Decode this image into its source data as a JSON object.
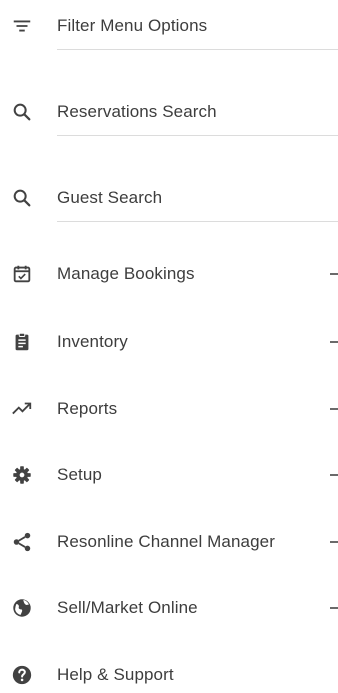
{
  "menu": {
    "filter": {
      "label": "Filter Menu Options",
      "icon": "filter-icon"
    },
    "search_items": [
      {
        "label": "Reservations Search",
        "icon": "search-icon"
      },
      {
        "label": "Guest Search",
        "icon": "search-icon"
      }
    ],
    "items": [
      {
        "label": "Manage Bookings",
        "icon": "calendar-check-icon",
        "expandable": true
      },
      {
        "label": "Inventory",
        "icon": "clipboard-icon",
        "expandable": true
      },
      {
        "label": "Reports",
        "icon": "trending-up-icon",
        "expandable": true
      },
      {
        "label": "Setup",
        "icon": "gear-icon",
        "expandable": true
      },
      {
        "label": "Resonline Channel Manager",
        "icon": "share-icon",
        "expandable": true
      },
      {
        "label": "Sell/Market Online",
        "icon": "globe-icon",
        "expandable": true
      },
      {
        "label": "Help & Support",
        "icon": "help-icon",
        "expandable": false
      }
    ],
    "colors": {
      "text": "#3d3d3d",
      "icon": "#424242",
      "divider": "#dcdcdc"
    }
  }
}
